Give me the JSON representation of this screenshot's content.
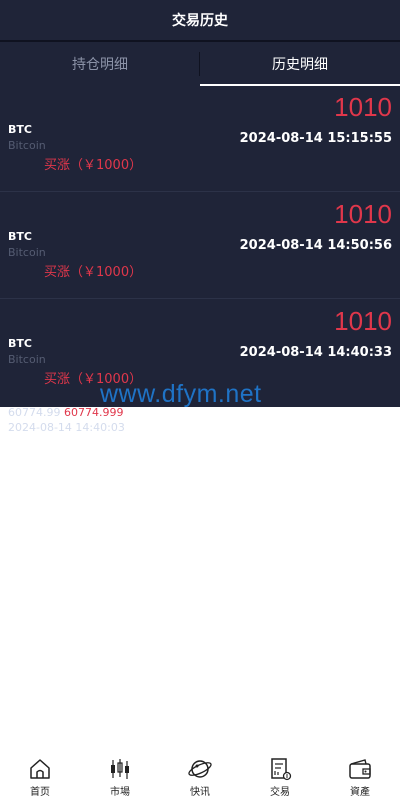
{
  "header": {
    "title": "交易历史"
  },
  "tabs": [
    {
      "label": "持仓明细",
      "active": false
    },
    {
      "label": "历史明细",
      "active": true
    }
  ],
  "records": [
    {
      "symbol": "BTC",
      "name": "Bitcoin",
      "amount": "1010",
      "time": "2024-08-14 15:15:55",
      "side": "买涨（￥1000）"
    },
    {
      "symbol": "BTC",
      "name": "Bitcoin",
      "amount": "1010",
      "time": "2024-08-14 14:50:56",
      "side": "买涨（￥1000）"
    },
    {
      "symbol": "BTC",
      "name": "Bitcoin",
      "amount": "1010",
      "time": "2024-08-14 14:40:33",
      "side": "买涨（￥1000）"
    }
  ],
  "overflow_text": {
    "price_a": "60774.99",
    "price_b": "60774.999",
    "time": "2024-08-14 14:40:03"
  },
  "watermark": "www.dfym.net",
  "bottom_nav": [
    {
      "label": "首页",
      "icon": "home-icon"
    },
    {
      "label": "市場",
      "icon": "candlestick-icon"
    },
    {
      "label": "快讯",
      "icon": "planet-icon"
    },
    {
      "label": "交易",
      "icon": "trade-document-icon"
    },
    {
      "label": "資產",
      "icon": "wallet-icon"
    }
  ],
  "colors": {
    "background_dark": "#1f2438",
    "accent_red": "#e0374b",
    "text_muted": "#555c72"
  }
}
